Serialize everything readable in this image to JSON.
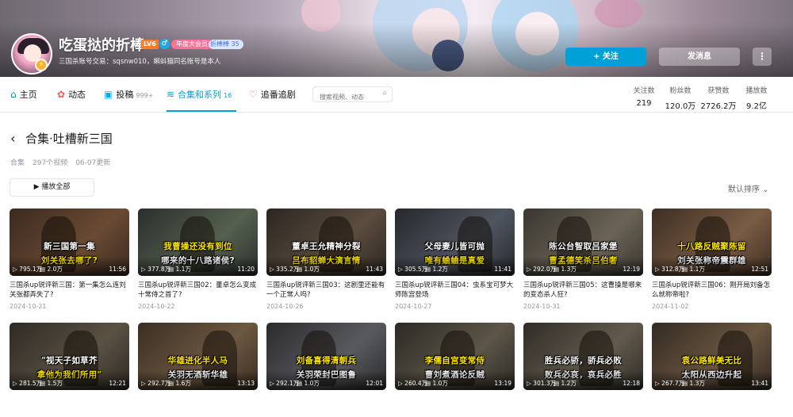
{
  "profile": {
    "name": "吃蛋挞的折棒",
    "level": "LV6",
    "gender_icon": "♂",
    "vip": "年度大会员",
    "medal": "折棒棒 35",
    "signature": "三国杀账号交易：sqsnw010，蝌蚪猫同名账号是本人",
    "follow_label": "+ 关注",
    "message_label": "发消息",
    "more_label": "⋮"
  },
  "nav": {
    "tabs": [
      {
        "icon": "⌂",
        "label": "主页",
        "count": ""
      },
      {
        "icon": "✿",
        "label": "动态",
        "count": ""
      },
      {
        "icon": "▣",
        "label": "投稿",
        "count": "999+"
      },
      {
        "icon": "≋",
        "label": "合集和系列",
        "count": "16"
      },
      {
        "icon": "♡",
        "label": "追番追剧",
        "count": ""
      }
    ],
    "search_placeholder": "搜索视频、动态"
  },
  "stats": [
    {
      "label": "关注数",
      "value": "219"
    },
    {
      "label": "粉丝数",
      "value": "120.0万"
    },
    {
      "label": "获赞数",
      "value": "2726.2万"
    },
    {
      "label": "播放数",
      "value": "9.2亿"
    }
  ],
  "collection": {
    "back_icon": "‹",
    "title": "合集·吐槽新三国",
    "type": "合集",
    "count": "297个视频",
    "updated": "06-07更新",
    "play_all": "▶ 播放全部",
    "sort": "默认排序 ⌄"
  },
  "videos": [
    {
      "cap1": "新三国第一集",
      "cap2": "刘关张去哪了?",
      "c1": "#ffffff",
      "c2": "#ffe600",
      "plays": "795.1万",
      "danmaku": "2.0万",
      "duration": "11:56",
      "title": "三国杀up锐评新三国：第一集怎么连刘关张都弄失了?",
      "date": "2024-10-21"
    },
    {
      "cap1": "我曹操还没有到位",
      "cap2": "哪来的十八路诸侯?",
      "c1": "#ffe600",
      "c2": "#ffffff",
      "plays": "377.8万",
      "danmaku": "1.1万",
      "duration": "11:20",
      "title": "三国杀up锐评新三国02：董卓怎么变成十常侍之首了?",
      "date": "2024-10-22"
    },
    {
      "cap1": "董卓王允精神分裂",
      "cap2": "吕布貂蝉大演言情",
      "c1": "#ffffff",
      "c2": "#ffe600",
      "plays": "335.2万",
      "danmaku": "1.0万",
      "duration": "11:43",
      "title": "三国杀up锐评新三国03：这剧里还能有一个正常人吗?",
      "date": "2024-10-26"
    },
    {
      "cap1": "父母妻儿皆可抛",
      "cap2": "唯有蛐蛐是真爱",
      "c1": "#ffffff",
      "c2": "#ffe600",
      "plays": "305.5万",
      "danmaku": "1.2万",
      "duration": "11:41",
      "title": "三国杀up锐评新三国04：虫系宝可梦大师陈宫登场",
      "date": "2024-10-27"
    },
    {
      "cap1": "陈公台智取吕家堡",
      "cap2": "曹孟德笑杀吕伯奢",
      "c1": "#ffffff",
      "c2": "#ffe600",
      "plays": "292.0万",
      "danmaku": "1.3万",
      "duration": "12:19",
      "title": "三国杀up锐评新三国05：这曹操是哪来的变态杀人狂?",
      "date": "2024-10-31"
    },
    {
      "cap1": "十八路反贼聚陈留",
      "cap2": "刘关张称帝震群雄",
      "c1": "#ffe600",
      "c2": "#ffffff",
      "plays": "312.8万",
      "danmaku": "1.1万",
      "duration": "12:51",
      "title": "三国杀up锐评新三国06：刚开局刘备怎么就称帝啦?",
      "date": "2024-11-02"
    },
    {
      "cap1": "\"视天子如草芥",
      "cap2": "拿他为我们所用\"",
      "c1": "#ffffff",
      "c2": "#ffe600",
      "plays": "281.5万",
      "danmaku": "1.5万",
      "duration": "12:21",
      "title": "",
      "date": ""
    },
    {
      "cap1": "华雄进化半人马",
      "cap2": "关羽无酒斩华雄",
      "c1": "#ffe600",
      "c2": "#ffffff",
      "plays": "292.7万",
      "danmaku": "1.6万",
      "duration": "13:13",
      "title": "",
      "date": ""
    },
    {
      "cap1": "刘备喜得清朝兵",
      "cap2": "关羽荣封巴图鲁",
      "c1": "#ffe600",
      "c2": "#ffffff",
      "plays": "292.1万",
      "danmaku": "1.0万",
      "duration": "12:01",
      "title": "",
      "date": ""
    },
    {
      "cap1": "李儒自宫变常侍",
      "cap2": "曹刘煮酒论反贼",
      "c1": "#ffe600",
      "c2": "#ffffff",
      "plays": "260.4万",
      "danmaku": "1.0万",
      "duration": "13:19",
      "title": "",
      "date": ""
    },
    {
      "cap1": "胜兵必骄，骄兵必败",
      "cap2": "败兵必哀，哀兵必胜",
      "c1": "#ffffff",
      "c2": "#ffffff",
      "plays": "301.3万",
      "danmaku": "1.2万",
      "duration": "12:18",
      "title": "",
      "date": ""
    },
    {
      "cap1": "袁公路鲜美无比",
      "cap2": "太阳从西边升起",
      "c1": "#ffe600",
      "c2": "#ffffff",
      "plays": "267.7万",
      "danmaku": "1.3万",
      "duration": "13:41",
      "title": "",
      "date": ""
    }
  ]
}
